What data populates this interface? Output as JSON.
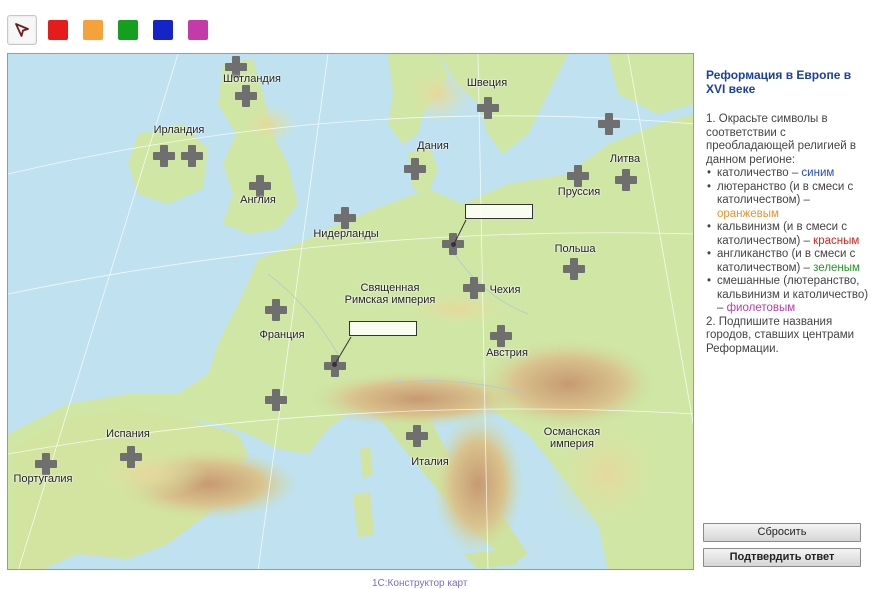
{
  "toolbar": {
    "pointer_tool": "pointer-icon",
    "colors": [
      {
        "name": "red",
        "hex": "#e61c1c"
      },
      {
        "name": "orange",
        "hex": "#f5a23a"
      },
      {
        "name": "green",
        "hex": "#14a01e"
      },
      {
        "name": "blue",
        "hex": "#1424c8"
      },
      {
        "name": "purple",
        "hex": "#c43aa8"
      }
    ]
  },
  "map": {
    "labels": {
      "scotland": "Шотландия",
      "sweden": "Швеция",
      "ireland": "Ирландия",
      "denmark": "Дания",
      "lithuania": "Литва",
      "england": "Англия",
      "prussia": "Пруссия",
      "netherlands": "Нидерланды",
      "poland": "Польша",
      "hre_line1": "Священная",
      "hre_line2": "Римская империя",
      "bohemia": "Чехия",
      "france": "Франция",
      "austria": "Австрия",
      "spain": "Испания",
      "ottoman_line1": "Османская",
      "ottoman_line2": "империя",
      "italy": "Италия",
      "portugal": "Португалия"
    },
    "city_inputs": [
      {
        "value": ""
      },
      {
        "value": ""
      }
    ]
  },
  "panel": {
    "title": "Реформация в Европе в XVI веке",
    "task1_intro": "1. Окрасьте символы в соответствии с преобладающей религией в данном регионе:",
    "items": [
      {
        "text": "католичество – ",
        "color_word": "синим"
      },
      {
        "text": "лютеранство (и в смеси с католичеством) – ",
        "color_word": "оранжевым"
      },
      {
        "text": "кальвинизм (и в смеси с католичеством) – ",
        "color_word": "красным"
      },
      {
        "text": "англиканство (и в смеси с католичеством) – ",
        "color_word": "зеленым"
      },
      {
        "text": "смешанные (лютеранство, кальвинизм и католичество) – ",
        "color_word": "фиолетовым"
      }
    ],
    "task2": "2. Подпишите названия городов, ставших центрами Реформации."
  },
  "buttons": {
    "reset": "Сбросить",
    "confirm": "Подтвердить ответ"
  },
  "footer": "1С:Конструктор карт"
}
